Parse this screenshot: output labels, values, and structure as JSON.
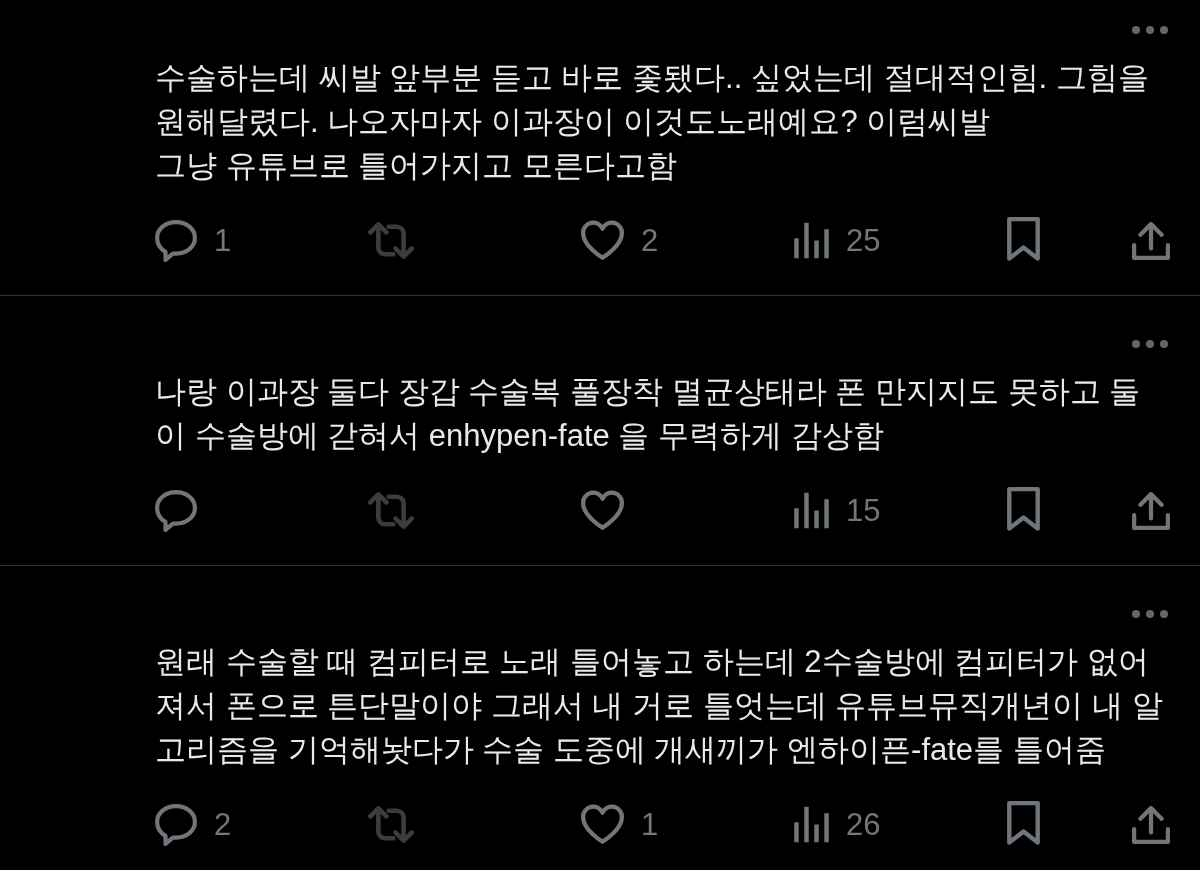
{
  "posts": [
    {
      "more_menu": true,
      "text": "수술하는데 씨발 앞부분 듣고 바로 좇됐다.. 싶었는데 절대적인힘. 그힘을\n원해달렸다. 나오자마자 이과장이 이것도노래예요? 이럼씨발\n그냥 유튜브로 틀어가지고 모른다고함",
      "replies": "1",
      "retweet_disabled": true,
      "likes": "2",
      "views": "25"
    },
    {
      "more_menu": true,
      "text": "나랑 이과장 둘다 장갑 수술복 풀장착 멸균상태라 폰 만지지도 못하고 둘\n이 수술방에 갇혀서 enhypen-fate 을 무력하게 감상함",
      "retweet_disabled": true,
      "views": "15"
    },
    {
      "more_menu": true,
      "text": "원래 수술할 때 컴피터로 노래 틀어놓고 하는데 2수술방에 컴피터가 없어\n져서 폰으로 튼단말이야 그래서 내 거로 틀엇는데 유튜브뮤직개년이 내 알\n고리즘을 기억해놧다가 수술 도중에 개새끼가 엔하이픈-fate를 틀어줌",
      "replies": "2",
      "retweet_disabled": true,
      "likes": "1",
      "views": "26"
    }
  ]
}
